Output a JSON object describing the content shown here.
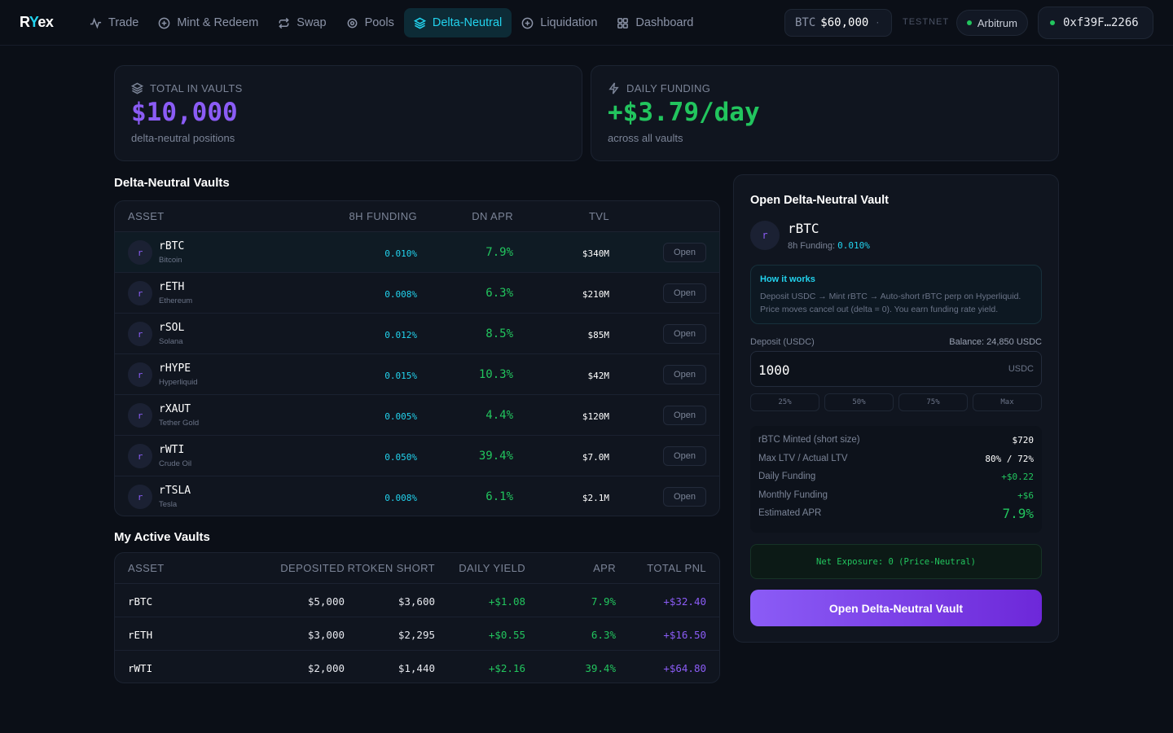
{
  "brand": {
    "logo_prefix": "R",
    "logo_y": "Y",
    "logo_suffix": "ex"
  },
  "nav": {
    "items": [
      {
        "label": "Trade",
        "icon": "activity-icon",
        "active": false
      },
      {
        "label": "Mint & Redeem",
        "icon": "plus-circle-icon",
        "active": false
      },
      {
        "label": "Swap",
        "icon": "swap-icon",
        "active": false
      },
      {
        "label": "Pools",
        "icon": "target-icon",
        "active": false
      },
      {
        "label": "Delta-Neutral",
        "icon": "layers-icon",
        "active": true
      },
      {
        "label": "Liquidation",
        "icon": "plus-circle-icon",
        "active": false
      },
      {
        "label": "Dashboard",
        "icon": "grid-icon",
        "active": false
      }
    ],
    "price_symbol": "BTC",
    "price_value": "$60,000",
    "price_dot": "·",
    "testnet_label": "TESTNET",
    "network": "Arbitrum",
    "wallet": "0xf39F…2266"
  },
  "stats": {
    "total": {
      "label": "TOTAL IN VAULTS",
      "value": "$10,000",
      "sub": "delta-neutral positions"
    },
    "funding": {
      "label": "DAILY FUNDING",
      "value": "+$3.79/day",
      "sub": "across all vaults"
    }
  },
  "vaults": {
    "title": "Delta-Neutral Vaults",
    "headers": {
      "asset": "ASSET",
      "funding": "8H FUNDING",
      "apr": "DN APR",
      "tvl": "TVL"
    },
    "open_label": "Open",
    "icon_letter": "r",
    "rows": [
      {
        "symbol": "rBTC",
        "name": "Bitcoin",
        "funding": "0.010%",
        "apr": "7.9%",
        "tvl": "$340M"
      },
      {
        "symbol": "rETH",
        "name": "Ethereum",
        "funding": "0.008%",
        "apr": "6.3%",
        "tvl": "$210M"
      },
      {
        "symbol": "rSOL",
        "name": "Solana",
        "funding": "0.012%",
        "apr": "8.5%",
        "tvl": "$85M"
      },
      {
        "symbol": "rHYPE",
        "name": "Hyperliquid",
        "funding": "0.015%",
        "apr": "10.3%",
        "tvl": "$42M"
      },
      {
        "symbol": "rXAUT",
        "name": "Tether Gold",
        "funding": "0.005%",
        "apr": "4.4%",
        "tvl": "$120M"
      },
      {
        "symbol": "rWTI",
        "name": "Crude Oil",
        "funding": "0.050%",
        "apr": "39.4%",
        "tvl": "$7.0M"
      },
      {
        "symbol": "rTSLA",
        "name": "Tesla",
        "funding": "0.008%",
        "apr": "6.1%",
        "tvl": "$2.1M"
      }
    ]
  },
  "active": {
    "title": "My Active Vaults",
    "headers": {
      "asset": "ASSET",
      "deposited": "DEPOSITED",
      "short": "RTOKEN SHORT",
      "yield": "DAILY YIELD",
      "apr": "APR",
      "pnl": "TOTAL PNL"
    },
    "rows": [
      {
        "asset": "rBTC",
        "deposited": "$5,000",
        "short": "$3,600",
        "yield": "+$1.08",
        "apr": "7.9%",
        "pnl": "+$32.40"
      },
      {
        "asset": "rETH",
        "deposited": "$3,000",
        "short": "$2,295",
        "yield": "+$0.55",
        "apr": "6.3%",
        "pnl": "+$16.50"
      },
      {
        "asset": "rWTI",
        "deposited": "$2,000",
        "short": "$1,440",
        "yield": "+$2.16",
        "apr": "39.4%",
        "pnl": "+$64.80"
      }
    ]
  },
  "panel": {
    "title": "Open Delta-Neutral Vault",
    "asset_symbol": "rBTC",
    "asset_icon_letter": "r",
    "funding_label": "8h Funding:",
    "funding_value": "0.010%",
    "how_title": "How it works",
    "how_line1": "Deposit USDC → Mint rBTC → Auto-short rBTC perp on Hyperliquid.",
    "how_line2": "Price moves cancel out (delta = 0). You earn funding rate yield.",
    "deposit_label": "Deposit (USDC)",
    "balance": "Balance: 24,850 USDC",
    "deposit_value": "1000",
    "deposit_unit": "USDC",
    "pct_buttons": [
      "25%",
      "50%",
      "75%",
      "Max"
    ],
    "summary": [
      {
        "key": "rBTC Minted (short size)",
        "value": "$720"
      },
      {
        "key": "Max LTV / Actual LTV",
        "value": "80% / 72%"
      },
      {
        "key": "Daily Funding",
        "value": "+$0.22"
      },
      {
        "key": "Monthly Funding",
        "value": "+$6"
      },
      {
        "key": "Estimated APR",
        "value": "7.9%"
      }
    ],
    "net_exposure": "Net Exposure: 0 (Price-Neutral)",
    "cta": "Open Delta-Neutral Vault"
  },
  "colors": {
    "accent_cyan": "#22d3ee",
    "accent_purple": "#8b5cf6",
    "positive_green": "#22c55e",
    "background": "#0b0f17"
  }
}
